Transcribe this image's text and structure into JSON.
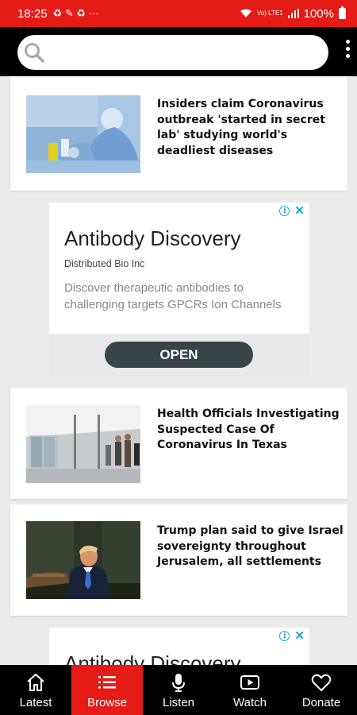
{
  "status_bar": {
    "time": "18:25",
    "notification_glyphs": "♻ ✎ ♻ ···",
    "network": "Vo) LTE1",
    "battery": "100%"
  },
  "search": {
    "placeholder": "",
    "value": ""
  },
  "articles": [
    {
      "title": "Insiders claim Coronavirus outbreak 'started in secret lab' studying world's deadliest diseases"
    },
    {
      "title": "Health Officials Investigating Suspected Case Of Coronavirus In Texas"
    },
    {
      "title": "Trump plan said to give Israel sovereignty throughout Jerusalem, all settlements"
    }
  ],
  "ads": [
    {
      "headline": "Antibody Discovery",
      "advertiser": "Distributed Bio Inc",
      "body": "Discover therapeutic antibodies to challenging targets GPCRs Ion Channels",
      "button": "OPEN",
      "info_icon": "i",
      "close_icon": "✕"
    },
    {
      "headline": "Antibody Discovery",
      "info_icon": "i",
      "close_icon": "✕"
    }
  ],
  "nav": {
    "active": "Browse",
    "items": [
      {
        "label": "Latest",
        "icon": "home-icon"
      },
      {
        "label": "Browse",
        "icon": "list-icon"
      },
      {
        "label": "Listen",
        "icon": "microphone-icon"
      },
      {
        "label": "Watch",
        "icon": "play-icon"
      },
      {
        "label": "Donate",
        "icon": "heart-icon"
      }
    ]
  },
  "colors": {
    "accent_red": "#e41b17",
    "header_black": "#000000",
    "ad_button": "#374448",
    "ad_icon_blue": "#1ea5df"
  }
}
